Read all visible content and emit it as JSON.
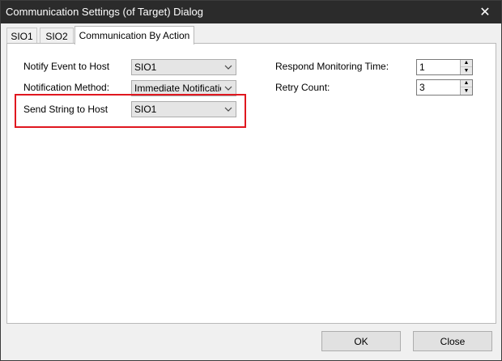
{
  "window": {
    "title": "Communication Settings (of Target) Dialog",
    "close_glyph": "✕"
  },
  "tabs": [
    {
      "label": "SIO1",
      "active": false
    },
    {
      "label": "SIO2",
      "active": false
    },
    {
      "label": "Communication By Action",
      "active": true
    }
  ],
  "form": {
    "notify_event": {
      "label": "Notify Event to Host",
      "value": "SIO1"
    },
    "notification_method": {
      "label": "Notification Method:",
      "value": "Immediate Notification"
    },
    "send_string": {
      "label": "Send String to Host",
      "value": "SIO1"
    },
    "respond_monitoring_time": {
      "label": "Respond Monitoring Time:",
      "value": "1"
    },
    "retry_count": {
      "label": "Retry Count:",
      "value": "3"
    }
  },
  "icons": {
    "dropdown": "chevron-down-icon",
    "spin_up": "triangle-up-icon",
    "spin_down": "triangle-down-icon"
  },
  "buttons": {
    "ok": "OK",
    "close": "Close"
  },
  "colors": {
    "titlebar": "#2b2b2b",
    "highlight": "#e0171f",
    "panel": "#ffffff",
    "window_bg": "#f0f0f0"
  }
}
